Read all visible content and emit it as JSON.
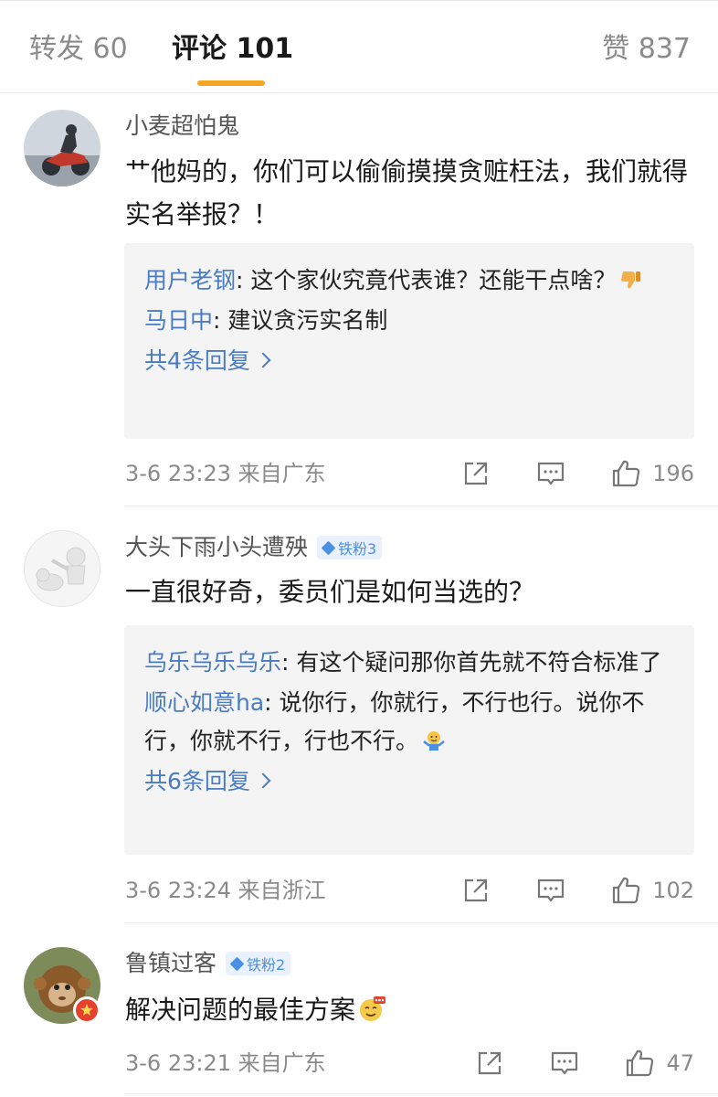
{
  "tabs": {
    "repost": "转发 60",
    "comment": "评论 101",
    "like": "赞 837"
  },
  "comments": [
    {
      "author": "小麦超怕鬼",
      "badge": "",
      "content": "艹他妈的，你们可以偷偷摸摸贪赃枉法，我们就得实名举报？！",
      "replies": [
        {
          "author": "用户老钢",
          "text": ": 这个家伙究竟代表谁？还能干点啥？",
          "emoji": "thumbs-down-icon"
        },
        {
          "author": "马日中",
          "text": ": 建议贪污实名制",
          "emoji": ""
        }
      ],
      "more": "共4条回复",
      "meta": "3-6 23:23  来自广东",
      "likes": "196"
    },
    {
      "author": "大头下雨小头遭殃",
      "badge": "铁粉3",
      "content": "一直很好奇，委员们是如何当选的？",
      "replies": [
        {
          "author": "乌乐乌乐乌乐",
          "text": ": 有这个疑问那你首先就不符合标准了",
          "emoji": ""
        },
        {
          "author": "顺心如意ha",
          "text": ": 说你行，你就行，不行也行。说你不行，你就不行，行也不行。",
          "emoji": "shrug-icon"
        }
      ],
      "more": "共6条回复",
      "meta": "3-6 23:24  来自浙江",
      "likes": "102"
    },
    {
      "author": "鲁镇过客",
      "badge": "铁粉2",
      "content": "解决问题的最佳方案",
      "replies": [],
      "more": "",
      "meta": "3-6 23:21  来自广东",
      "likes": "47"
    }
  ],
  "colors": {
    "accent": "#f5a623",
    "link": "#4a7cc3",
    "badge": "#4a90e2",
    "muted": "#8a8a8a"
  }
}
